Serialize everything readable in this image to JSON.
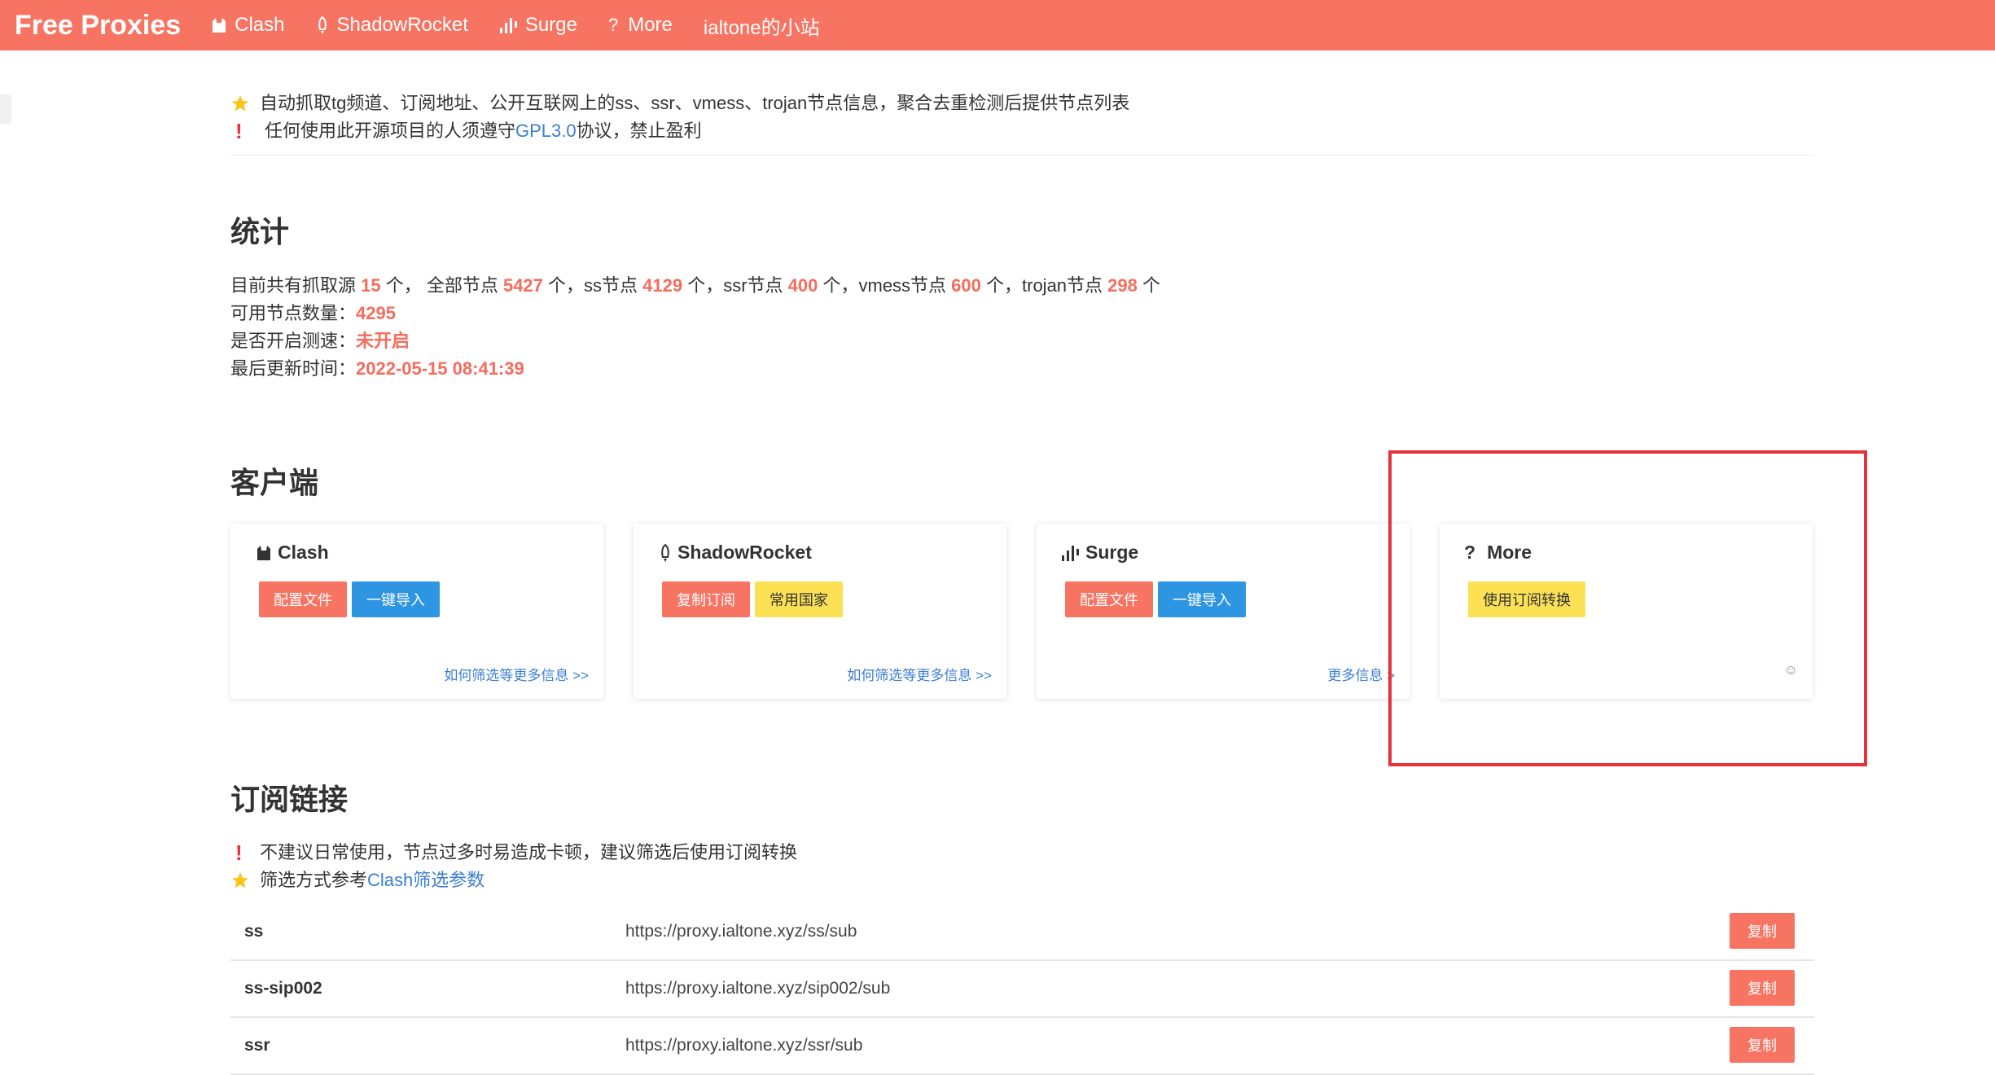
{
  "nav": {
    "brand": "Free Proxies",
    "items": [
      {
        "label": "Clash",
        "icon": "cat-icon"
      },
      {
        "label": "ShadowRocket",
        "icon": "rocket-icon"
      },
      {
        "label": "Surge",
        "icon": "signal-bars-icon"
      },
      {
        "label": "More",
        "icon": "question-icon"
      },
      {
        "label": "ialtone的小站",
        "icon": ""
      }
    ]
  },
  "notice": {
    "line1": "自动抓取tg频道、订阅地址、公开互联网上的ss、ssr、vmess、trojan节点信息，聚合去重检测后提供节点列表",
    "line2_pre": "任何使用此开源项目的人须遵守",
    "line2_link": "GPL3.0",
    "line2_post": "协议，禁止盈利"
  },
  "stats": {
    "heading": "统计",
    "line1": {
      "t1": "目前共有抓取源 ",
      "sources": "15",
      "t2": " 个，  全部节点 ",
      "all": "5427",
      "t3": " 个，ss节点 ",
      "ss": "4129",
      "t4": " 个，ssr节点 ",
      "ssr": "400",
      "t5": " 个，vmess节点 ",
      "vmess": "600",
      "t6": " 个，trojan节点 ",
      "trojan": "298",
      "t7": " 个"
    },
    "available_label": "可用节点数量：",
    "available": "4295",
    "speedtest_label": "是否开启测速：",
    "speedtest": "未开启",
    "updated_label": "最后更新时间：",
    "updated": "2022-05-15 08:41:39"
  },
  "clients": {
    "heading": "客户端",
    "cards": [
      {
        "title": "Clash",
        "btn1": "配置文件",
        "btn2": "一键导入",
        "link": "如何筛选等更多信息 >>"
      },
      {
        "title": "ShadowRocket",
        "btn1": "复制订阅",
        "btn2": "常用国家",
        "link": "如何筛选等更多信息 >>"
      },
      {
        "title": "Surge",
        "btn1": "配置文件",
        "btn2": "一键导入",
        "link": "更多信息 >"
      },
      {
        "title": "More",
        "btn1": "使用订阅转换",
        "smile": "☺"
      }
    ]
  },
  "subscriptions": {
    "heading": "订阅链接",
    "notice1": "不建议日常使用，节点过多时易造成卡顿，建议筛选后使用订阅转换",
    "notice2_pre": "筛选方式参考",
    "notice2_link": "Clash筛选参数",
    "rows": [
      {
        "name": "ss",
        "url": "https://proxy.ialtone.xyz/ss/sub",
        "copy": "复制"
      },
      {
        "name": "ss-sip002",
        "url": "https://proxy.ialtone.xyz/sip002/sub",
        "copy": "复制"
      },
      {
        "name": "ssr",
        "url": "https://proxy.ialtone.xyz/ssr/sub",
        "copy": "复制"
      }
    ]
  },
  "colors": {
    "accent": "#f77462",
    "blue": "#2d95e2",
    "yellow": "#fce155",
    "number": "#f56c5c",
    "highlight": "#e8303a"
  }
}
